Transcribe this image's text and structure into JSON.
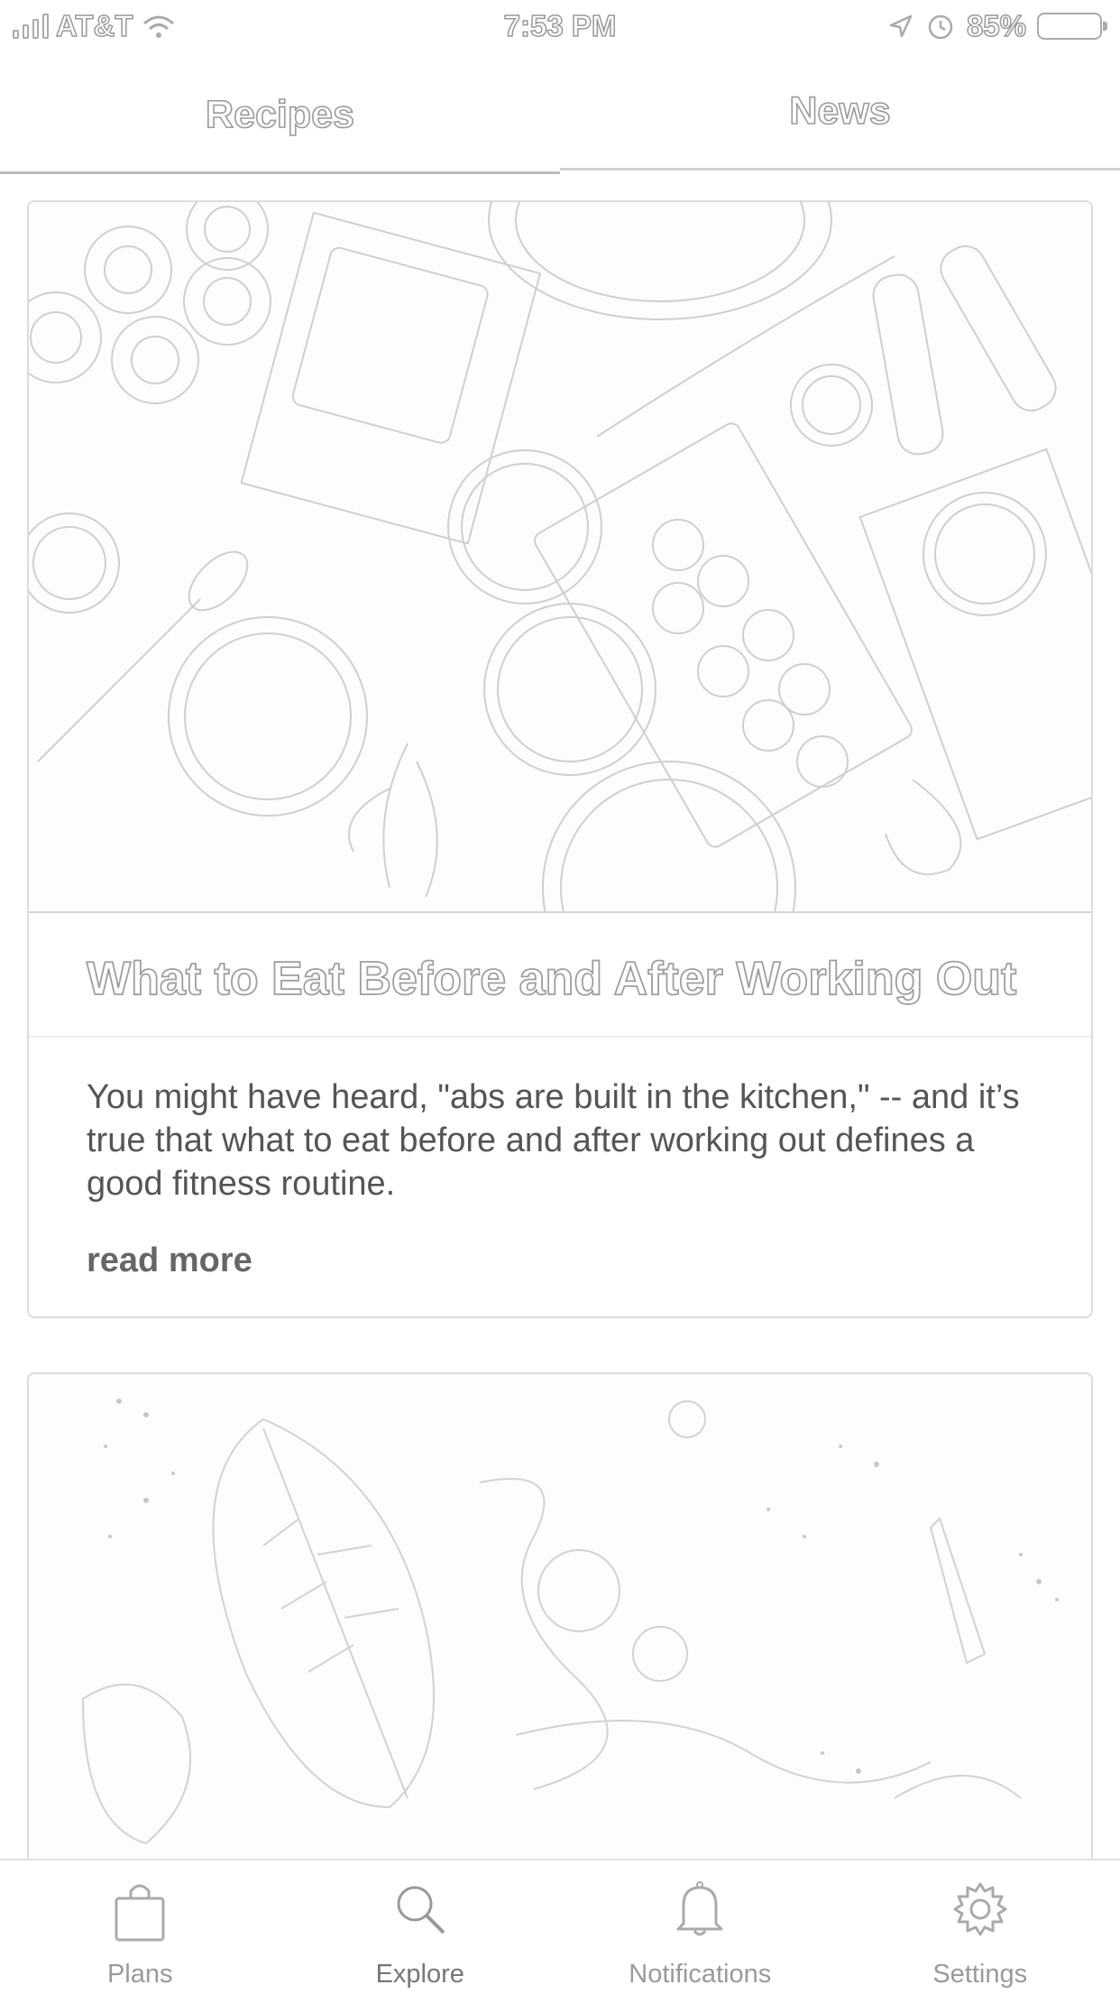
{
  "status_bar": {
    "carrier": "AT&T",
    "time": "7:53 PM",
    "battery": "85%"
  },
  "top_tabs": [
    {
      "label": "Recipes"
    },
    {
      "label": "News"
    }
  ],
  "articles": [
    {
      "title": "What to Eat Before and After Working Out",
      "excerpt": "You might have heard, \"abs are built in the kitchen,\" -- and it’s true that what to eat before and after working out defines a good fitness routine.",
      "read_more": "read more"
    }
  ],
  "bottom_nav": [
    {
      "label": "Plans",
      "icon": "shopping-bag-icon"
    },
    {
      "label": "Explore",
      "icon": "search-icon"
    },
    {
      "label": "Notifications",
      "icon": "bell-icon"
    },
    {
      "label": "Settings",
      "icon": "gear-icon"
    }
  ],
  "colors": {
    "border": "#dcdcdc",
    "text": "#555555",
    "muted": "#9a9a9a"
  }
}
